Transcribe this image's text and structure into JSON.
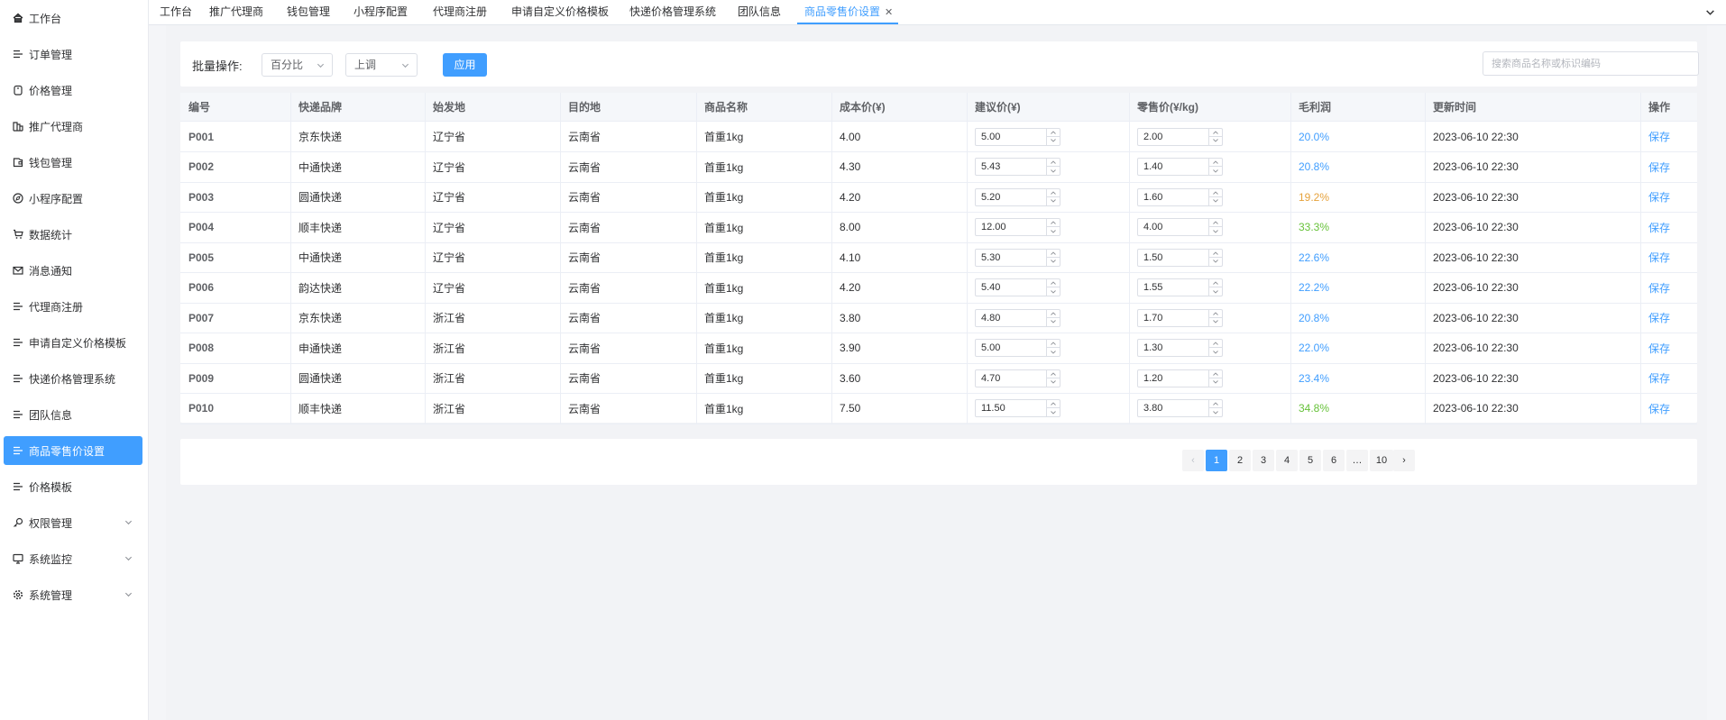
{
  "sidebar": {
    "items": [
      {
        "label": "工作台",
        "icon": "home-icon"
      },
      {
        "label": "订单管理",
        "icon": "list-icon"
      },
      {
        "label": "价格管理",
        "icon": "price-tag-icon"
      },
      {
        "label": "推广代理商",
        "icon": "building-icon"
      },
      {
        "label": "钱包管理",
        "icon": "wallet-icon"
      },
      {
        "label": "小程序配置",
        "icon": "compass-icon"
      },
      {
        "label": "数据统计",
        "icon": "cart-icon"
      },
      {
        "label": "消息通知",
        "icon": "mail-icon"
      },
      {
        "label": "代理商注册",
        "icon": "list-icon"
      },
      {
        "label": "申请自定义价格模板",
        "icon": "list-icon"
      },
      {
        "label": "快递价格管理系统",
        "icon": "list-icon"
      },
      {
        "label": "团队信息",
        "icon": "list-icon"
      },
      {
        "label": "商品零售价设置",
        "icon": "list-icon",
        "active": true
      },
      {
        "label": "价格模板",
        "icon": "list-icon"
      },
      {
        "label": "权限管理",
        "icon": "key-icon",
        "expandable": true
      },
      {
        "label": "系统监控",
        "icon": "monitor-icon",
        "expandable": true
      },
      {
        "label": "系统管理",
        "icon": "gear-icon",
        "expandable": true
      }
    ]
  },
  "tabs": [
    {
      "label": "工作台"
    },
    {
      "label": "推广代理商"
    },
    {
      "label": "钱包管理"
    },
    {
      "label": "小程序配置"
    },
    {
      "label": "代理商注册"
    },
    {
      "label": "申请自定义价格模板"
    },
    {
      "label": "快递价格管理系统"
    },
    {
      "label": "团队信息"
    },
    {
      "label": "商品零售价设置",
      "active": true
    }
  ],
  "toolbar": {
    "batch_label": "批量操作:",
    "mode_select": "百分比",
    "direction_select": "上调",
    "apply_label": "应用",
    "search_placeholder": "搜索商品名称或标识编码"
  },
  "table": {
    "headers": [
      "编号",
      "快递品牌",
      "始发地",
      "目的地",
      "商品名称",
      "成本价(¥)",
      "建议价(¥)",
      "零售价(¥/kg)",
      "毛利润",
      "更新时间",
      "操作"
    ],
    "rows": [
      {
        "code": "P001",
        "brand": "京东快递",
        "origin": "辽宁省",
        "dest": "云南省",
        "name": "首重1kg",
        "cost": "4.00",
        "suggest": "5.00",
        "retail": "2.00",
        "margin": "20.0%",
        "margin_level": "normal",
        "updated": "2023-06-10 22:30",
        "action": "保存"
      },
      {
        "code": "P002",
        "brand": "中通快递",
        "origin": "辽宁省",
        "dest": "云南省",
        "name": "首重1kg",
        "cost": "4.30",
        "suggest": "5.43",
        "retail": "1.40",
        "margin": "20.8%",
        "margin_level": "normal",
        "updated": "2023-06-10 22:30",
        "action": "保存"
      },
      {
        "code": "P003",
        "brand": "圆通快递",
        "origin": "辽宁省",
        "dest": "云南省",
        "name": "首重1kg",
        "cost": "4.20",
        "suggest": "5.20",
        "retail": "1.60",
        "margin": "19.2%",
        "margin_level": "warn",
        "updated": "2023-06-10 22:30",
        "action": "保存"
      },
      {
        "code": "P004",
        "brand": "顺丰快递",
        "origin": "辽宁省",
        "dest": "云南省",
        "name": "首重1kg",
        "cost": "8.00",
        "suggest": "12.00",
        "retail": "4.00",
        "margin": "33.3%",
        "margin_level": "good",
        "updated": "2023-06-10 22:30",
        "action": "保存"
      },
      {
        "code": "P005",
        "brand": "中通快递",
        "origin": "辽宁省",
        "dest": "云南省",
        "name": "首重1kg",
        "cost": "4.10",
        "suggest": "5.30",
        "retail": "1.50",
        "margin": "22.6%",
        "margin_level": "normal",
        "updated": "2023-06-10 22:30",
        "action": "保存"
      },
      {
        "code": "P006",
        "brand": "韵达快递",
        "origin": "辽宁省",
        "dest": "云南省",
        "name": "首重1kg",
        "cost": "4.20",
        "suggest": "5.40",
        "retail": "1.55",
        "margin": "22.2%",
        "margin_level": "normal",
        "updated": "2023-06-10 22:30",
        "action": "保存"
      },
      {
        "code": "P007",
        "brand": "京东快递",
        "origin": "浙江省",
        "dest": "云南省",
        "name": "首重1kg",
        "cost": "3.80",
        "suggest": "4.80",
        "retail": "1.70",
        "margin": "20.8%",
        "margin_level": "normal",
        "updated": "2023-06-10 22:30",
        "action": "保存"
      },
      {
        "code": "P008",
        "brand": "申通快递",
        "origin": "浙江省",
        "dest": "云南省",
        "name": "首重1kg",
        "cost": "3.90",
        "suggest": "5.00",
        "retail": "1.30",
        "margin": "22.0%",
        "margin_level": "normal",
        "updated": "2023-06-10 22:30",
        "action": "保存"
      },
      {
        "code": "P009",
        "brand": "圆通快递",
        "origin": "浙江省",
        "dest": "云南省",
        "name": "首重1kg",
        "cost": "3.60",
        "suggest": "4.70",
        "retail": "1.20",
        "margin": "23.4%",
        "margin_level": "normal",
        "updated": "2023-06-10 22:30",
        "action": "保存"
      },
      {
        "code": "P010",
        "brand": "顺丰快递",
        "origin": "浙江省",
        "dest": "云南省",
        "name": "首重1kg",
        "cost": "7.50",
        "suggest": "11.50",
        "retail": "3.80",
        "margin": "34.8%",
        "margin_level": "good",
        "updated": "2023-06-10 22:30",
        "action": "保存"
      }
    ]
  },
  "pagination": {
    "prev": "‹",
    "pages": [
      "1",
      "2",
      "3",
      "4",
      "5",
      "6",
      "…",
      "10"
    ],
    "current": "1",
    "next": "›"
  },
  "colors": {
    "accent": "#409eff",
    "warn": "#e6a23c",
    "good": "#67c23a"
  }
}
